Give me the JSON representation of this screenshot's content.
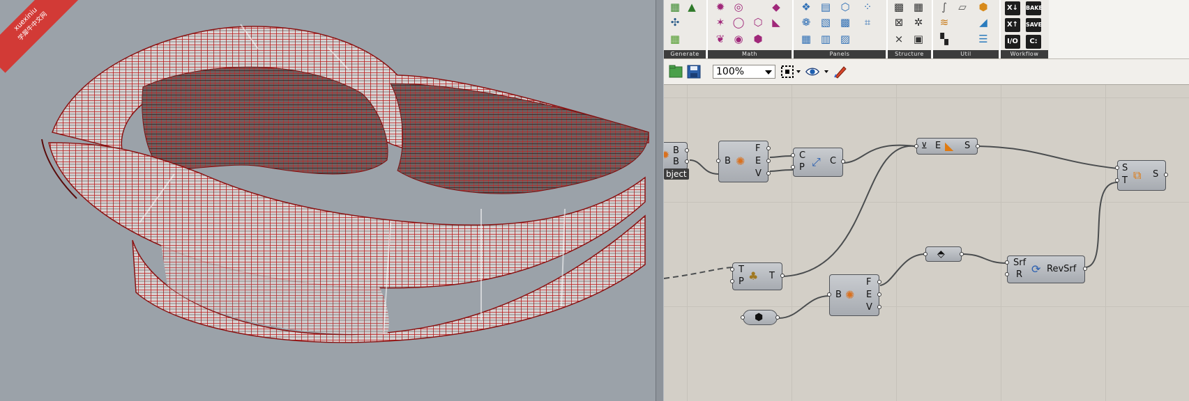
{
  "watermark": {
    "line1": "xuexiniu",
    "line2": "学犀牛中文网"
  },
  "ribbon": {
    "groups": [
      {
        "label": "Generate"
      },
      {
        "label": "Math"
      },
      {
        "label": "Panels"
      },
      {
        "label": "Structure"
      },
      {
        "label": "Util"
      },
      {
        "label": "Workflow"
      }
    ],
    "workflow_buttons": [
      "X↓",
      "BAKE",
      "X↑",
      "SAVE",
      "I/O",
      "C:"
    ]
  },
  "toolbar": {
    "zoom_value": "100%"
  },
  "canvas": {
    "components": {
      "left_partial": {
        "inputs": [
          "B",
          "B"
        ],
        "tag": "bject"
      },
      "explode_a": {
        "input": "B",
        "outputs": [
          "F",
          "E",
          "V"
        ]
      },
      "curve_param": {
        "inputs": [
          "C",
          "P"
        ],
        "output": "C"
      },
      "edge_extrude": {
        "input": "E",
        "output": "S"
      },
      "surface_transform": {
        "inputs": [
          "S",
          "T"
        ],
        "output": "S"
      },
      "transform_node": {
        "inputs": [
          "T",
          "P"
        ],
        "output": "T"
      },
      "explode_b": {
        "input": "B",
        "outputs": [
          "F",
          "E",
          "V"
        ]
      },
      "revsrf": {
        "inputs": [
          "Srf",
          "R"
        ],
        "label": "RevSrf"
      }
    },
    "colors": {
      "wire": "#4a4d4f",
      "canvas": "#d3cfc7",
      "model_red": "#c21d1d"
    }
  },
  "icons": {
    "open": "folder-icon",
    "save": "floppy-icon",
    "select": "select-frame-icon",
    "preview": "eye-icon",
    "sketch": "pen-icon"
  }
}
